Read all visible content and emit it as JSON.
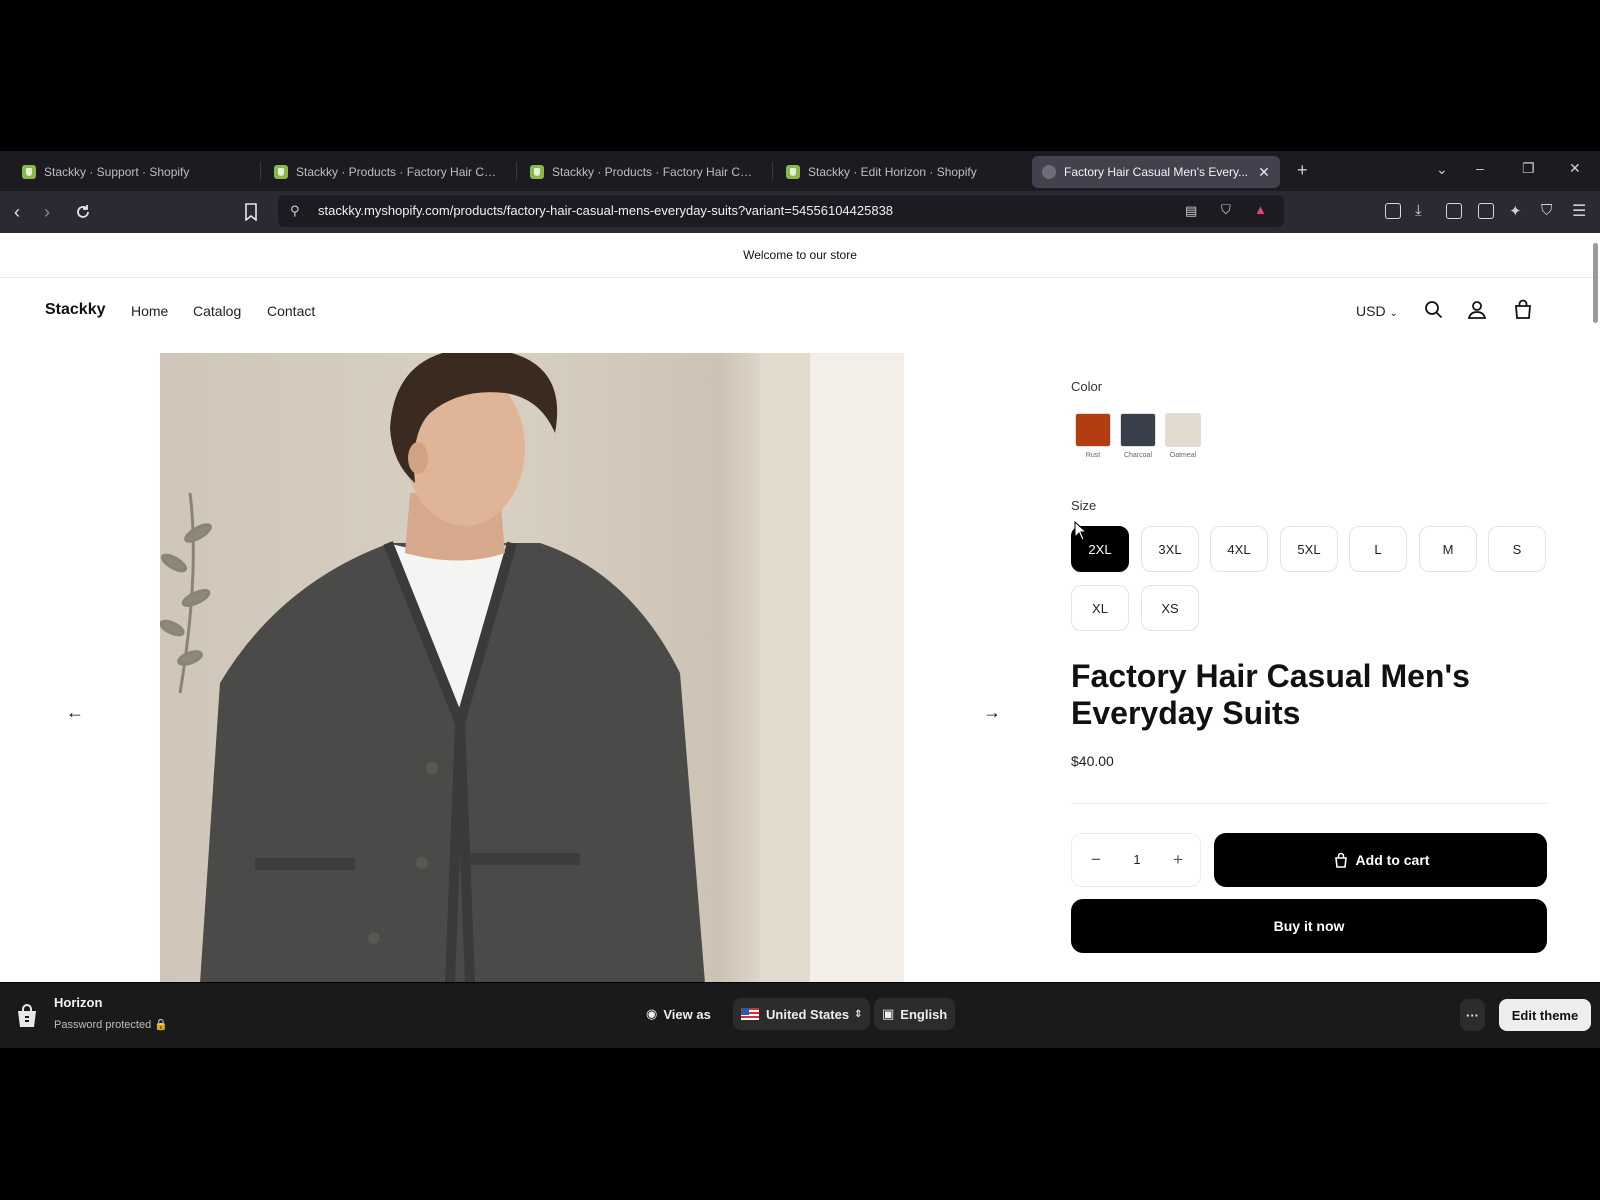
{
  "browser": {
    "tabs": [
      {
        "label": "Stackky · Support · Shopify"
      },
      {
        "label": "Stackky · Products · Factory Hair Cas..."
      },
      {
        "label": "Stackky · Products · Factory Hair Cas..."
      },
      {
        "label": "Stackky · Edit Horizon · Shopify"
      },
      {
        "label": "Factory Hair Casual Men's Every..."
      }
    ],
    "new_tab": "+",
    "tab_close": "✕",
    "url": "stackky.myshopify.com/products/factory-hair-casual-mens-everyday-suits?variant=54556104425838"
  },
  "store": {
    "announcement": "Welcome to our store",
    "brand": "Stackky",
    "nav": [
      "Home",
      "Catalog",
      "Contact"
    ],
    "currency": "USD"
  },
  "product": {
    "color_label": "Color",
    "colors": [
      {
        "name": "Rust",
        "hex": "#b13d10"
      },
      {
        "name": "Charcoal",
        "hex": "#38404c"
      },
      {
        "name": "Oatmeal",
        "hex": "#e2dbd0"
      }
    ],
    "size_label": "Size",
    "sizes": [
      "2XL",
      "3XL",
      "4XL",
      "5XL",
      "L",
      "M",
      "S",
      "XL",
      "XS"
    ],
    "selected_size": "2XL",
    "title": "Factory Hair Casual Men's Everyday Suits",
    "price": "$40.00",
    "quantity": "1",
    "qty_minus": "−",
    "qty_plus": "+",
    "add_to_cart": "Add to cart",
    "buy_now": "Buy it now",
    "prev_arrow": "←",
    "next_arrow": "→"
  },
  "preview_bar": {
    "theme": "Horizon",
    "status": "Password protected",
    "view_as": "View as",
    "country": "United States",
    "language": "English",
    "more": "···",
    "edit_theme": "Edit theme"
  }
}
